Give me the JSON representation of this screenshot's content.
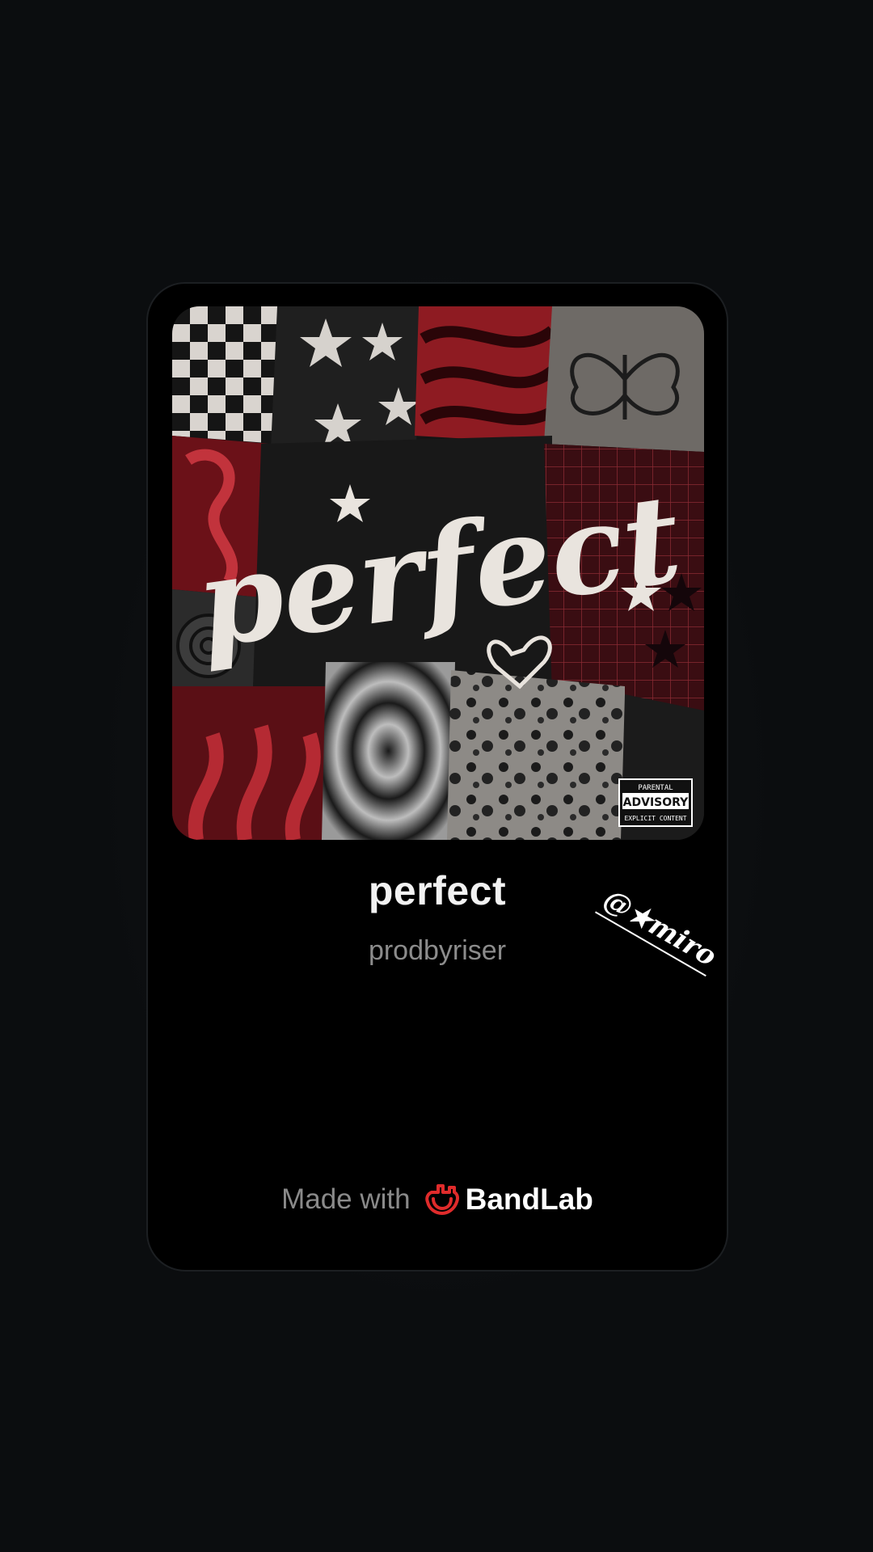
{
  "track": {
    "title": "perfect",
    "artist": "prodbyriser",
    "cover_art": {
      "title_text": "perfect",
      "label_lines": [
        "PARENTAL",
        "ADVISORY",
        "EXPLICIT CONTENT"
      ]
    }
  },
  "sticker": {
    "text": "@★miro"
  },
  "footer": {
    "made_with": "Made with",
    "brand_name": "BandLab",
    "brand_icon": "bandlab-logo-icon"
  },
  "colors": {
    "background": "#0b0d0f",
    "card": "#000000",
    "brand_red": "#e02b2b",
    "title": "#f2f2f2",
    "subtitle": "#8c8c8c"
  }
}
